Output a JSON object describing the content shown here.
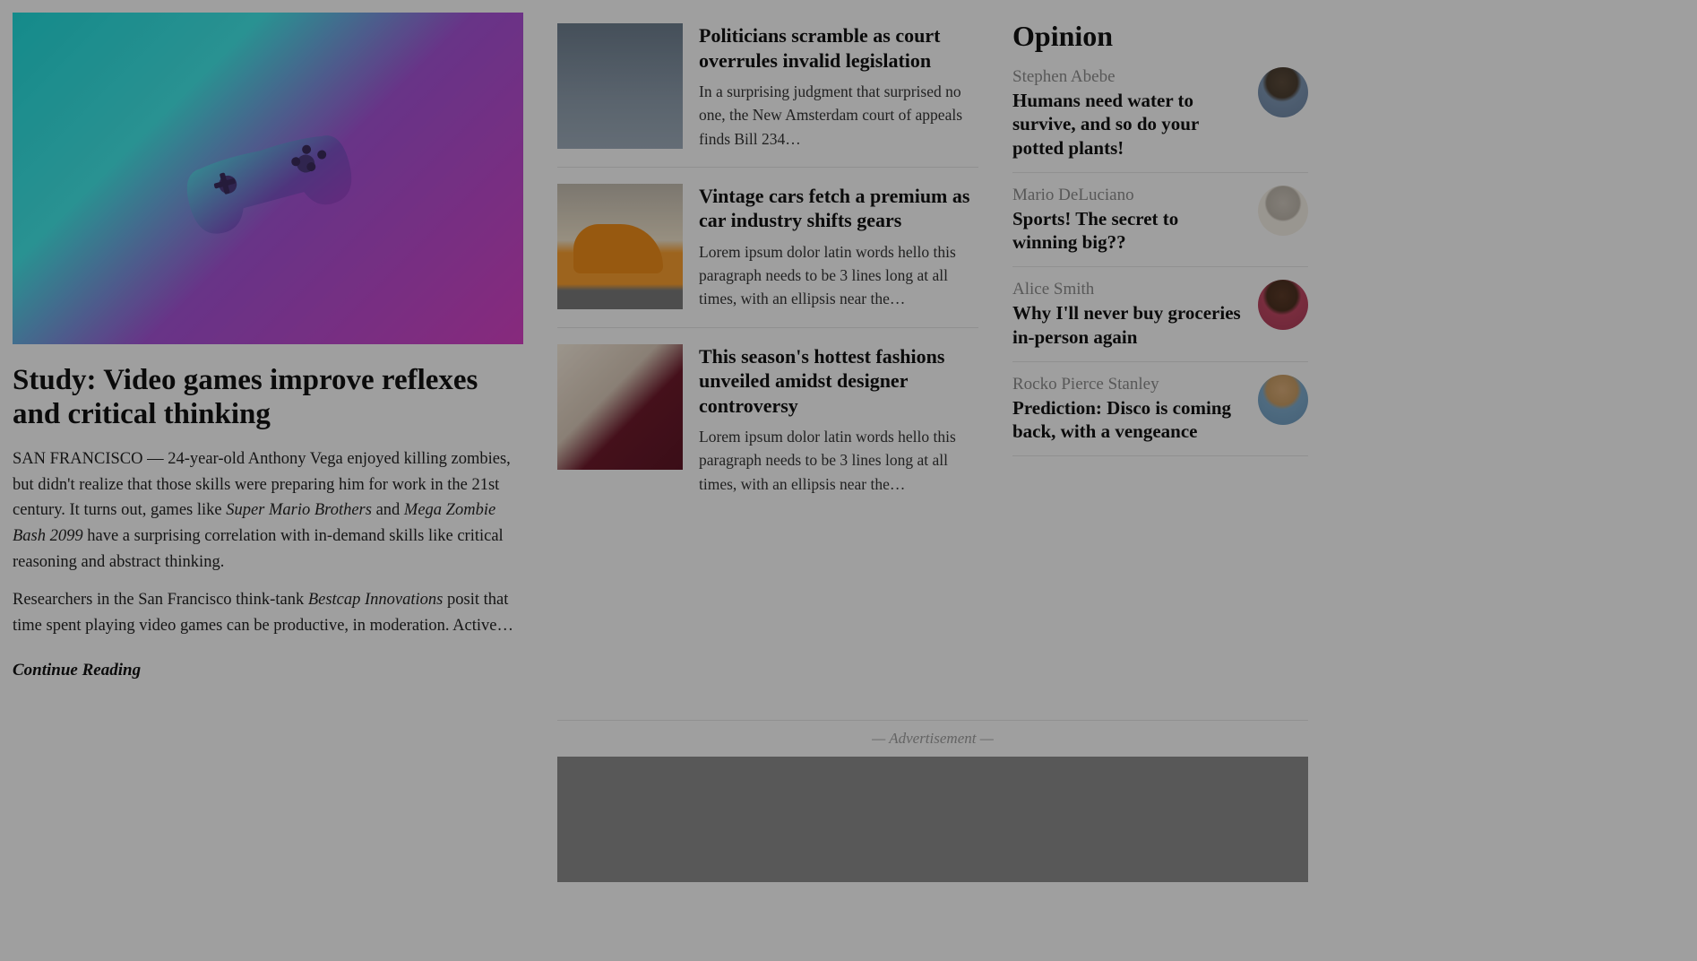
{
  "main_story": {
    "headline": "Study: Video games improve reflexes and critical thinking",
    "p1_prefix": "SAN FRANCISCO — 24-year-old Anthony Vega enjoyed killing zombies, but didn't realize that those skills were preparing him for work in the 21st century. It turns out, games like ",
    "p1_em1": "Super Mario Brothers",
    "p1_mid": " and ",
    "p1_em2": "Mega Zombie Bash 2099",
    "p1_suffix": " have a surprising correlation with in-demand skills like critical reasoning and abstract thinking.",
    "p2_prefix": "Researchers in the San Francisco think-tank ",
    "p2_em": "Bestcap Innovations",
    "p2_suffix": " posit that time spent playing video games can be productive, in moderation. Active…",
    "continue": "Continue Reading"
  },
  "secondary": [
    {
      "headline": "Politicians scramble as court overrules invalid legislation",
      "excerpt": "In a surprising judgment that surprised no one, the New Amsterdam court of appeals finds Bill 234…",
      "thumb": "thumb-politics"
    },
    {
      "headline": "Vintage cars fetch a premium as car industry shifts gears",
      "excerpt": "Lorem ipsum dolor latin words hello this paragraph needs to be 3 lines long at all times, with an ellipsis near the…",
      "thumb": "thumb-car"
    },
    {
      "headline": "This season's hottest fashions unveiled amidst designer controversy",
      "excerpt": "Lorem ipsum dolor latin words hello this paragraph needs to be 3 lines long at all times, with an ellipsis near the…",
      "thumb": "thumb-fashion"
    }
  ],
  "opinion": {
    "title": "Opinion",
    "items": [
      {
        "author": "Stephen Abebe",
        "headline": "Humans need water to survive, and so do your potted plants!",
        "avatar": "av1"
      },
      {
        "author": "Mario DeLuciano",
        "headline": "Sports! The secret to winning big??",
        "avatar": "av2"
      },
      {
        "author": "Alice Smith",
        "headline": "Why I'll never buy groceries in-person again",
        "avatar": "av3"
      },
      {
        "author": "Rocko Pierce Stanley",
        "headline": "Prediction: Disco is coming back, with a vengeance",
        "avatar": "av4"
      }
    ]
  },
  "advertisement": {
    "label": "— Advertisement —"
  }
}
